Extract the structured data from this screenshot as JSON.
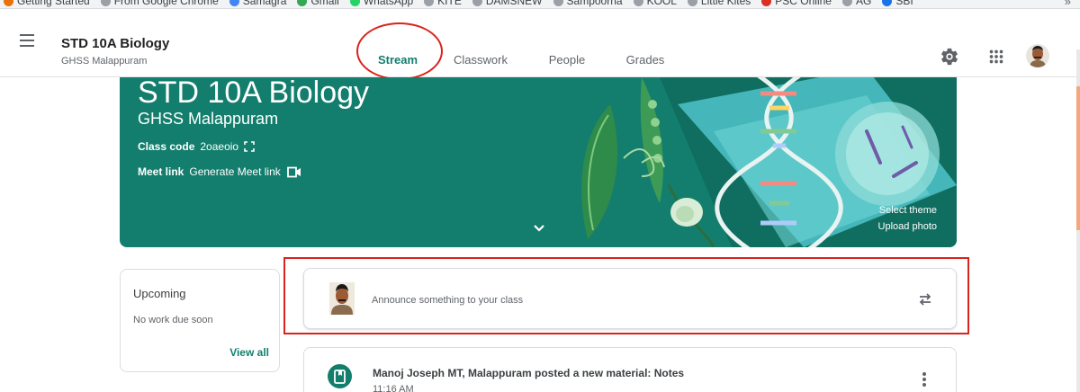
{
  "bookmarks": [
    {
      "label": "Getting Started",
      "color": "#e8710a"
    },
    {
      "label": "From Google Chrome",
      "color": "#9aa0a6"
    },
    {
      "label": "Samagra",
      "color": "#4285f4"
    },
    {
      "label": "Gmail",
      "color": "#34a853"
    },
    {
      "label": "WhatsApp",
      "color": "#25d366"
    },
    {
      "label": "KITE",
      "color": "#9aa0a6"
    },
    {
      "label": "DAMSNEW",
      "color": "#9aa0a6"
    },
    {
      "label": "Sampoorna",
      "color": "#9aa0a6"
    },
    {
      "label": "KOOL",
      "color": "#9aa0a6"
    },
    {
      "label": "Little Kites",
      "color": "#9aa0a6"
    },
    {
      "label": "PSC Online",
      "color": "#d93025"
    },
    {
      "label": "AG",
      "color": "#9aa0a6"
    },
    {
      "label": "SBI",
      "color": "#1a73e8"
    }
  ],
  "bookmarks_more": "»",
  "topbar": {
    "title": "STD 10A Biology",
    "subtitle": "GHSS Malappuram",
    "tabs": [
      {
        "label": "Stream",
        "active": true
      },
      {
        "label": "Classwork"
      },
      {
        "label": "People"
      },
      {
        "label": "Grades"
      }
    ],
    "icons": [
      "menu-icon",
      "gear-icon",
      "apps-grid-icon",
      "account-avatar"
    ]
  },
  "banner": {
    "title": "STD 10A Biology",
    "subtitle": "GHSS Malappuram",
    "class_code_label": "Class code",
    "class_code": "2oaeoio",
    "meet_label": "Meet link",
    "meet_action": "Generate Meet link",
    "select_theme": "Select theme",
    "upload_photo": "Upload photo",
    "color": "#137e6d"
  },
  "upcoming": {
    "title": "Upcoming",
    "empty": "No work due soon",
    "view_all": "View all"
  },
  "announce": {
    "placeholder": "Announce something to your class"
  },
  "post": {
    "title": "Manoj Joseph MT, Malappuram posted a new material: Notes",
    "time": "11:16 AM"
  },
  "colors": {
    "accent": "#137e6d",
    "annotation": "#d9231d"
  }
}
